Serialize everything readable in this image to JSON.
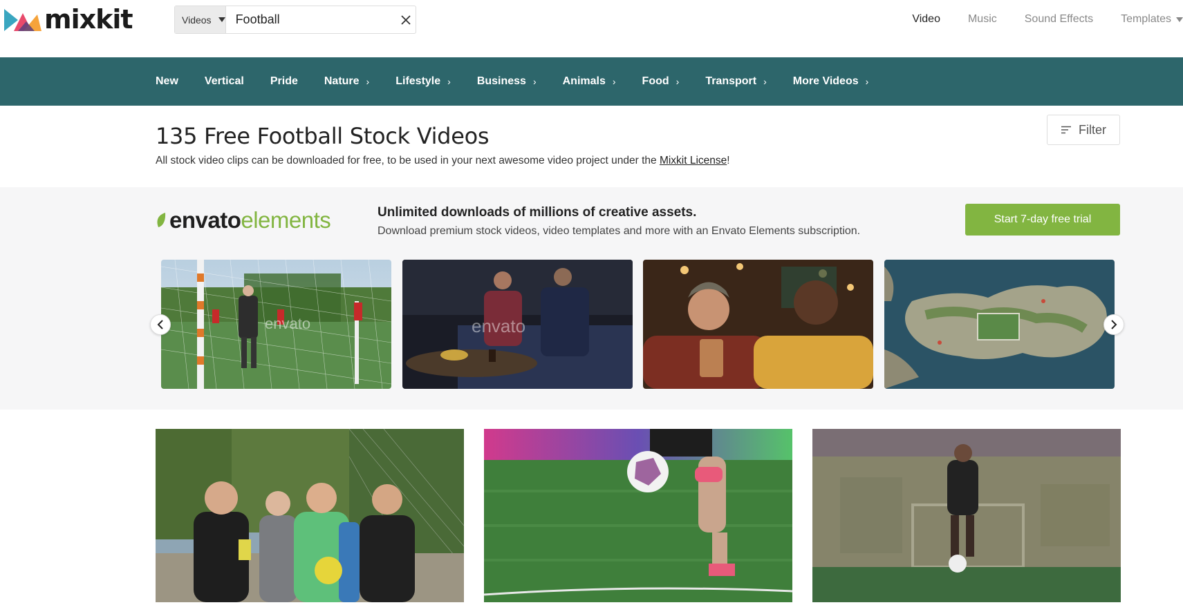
{
  "brand": {
    "name": "mixkit"
  },
  "search": {
    "type_label": "Videos",
    "query": "Football"
  },
  "topnav": {
    "items": [
      "Video",
      "Music",
      "Sound Effects",
      "Templates"
    ]
  },
  "categories": {
    "items": [
      {
        "label": "New",
        "has_chevron": false
      },
      {
        "label": "Vertical",
        "has_chevron": false
      },
      {
        "label": "Pride",
        "has_chevron": false
      },
      {
        "label": "Nature",
        "has_chevron": true
      },
      {
        "label": "Lifestyle",
        "has_chevron": true
      },
      {
        "label": "Business",
        "has_chevron": true
      },
      {
        "label": "Animals",
        "has_chevron": true
      },
      {
        "label": "Food",
        "has_chevron": true
      },
      {
        "label": "Transport",
        "has_chevron": true
      },
      {
        "label": "More Videos",
        "has_chevron": true
      }
    ]
  },
  "page": {
    "title": "135 Free Football Stock Videos",
    "subtitle_prefix": "All stock video clips can be downloaded for free, to be used in your next awesome video project under the ",
    "subtitle_link": "Mixkit License",
    "subtitle_suffix": "!",
    "filter_label": "Filter"
  },
  "promo": {
    "logo_part1": "envato",
    "logo_part2": "elements",
    "headline": "Unlimited downloads of millions of creative assets.",
    "subtext": "Download premium stock videos, video templates and more with an Envato Elements subscription.",
    "cta_label": "Start 7-day free trial",
    "watermark": "envato"
  },
  "colors": {
    "category_bar": "#2d666b",
    "cta_green": "#82b541",
    "promo_bg": "#f6f6f7"
  }
}
